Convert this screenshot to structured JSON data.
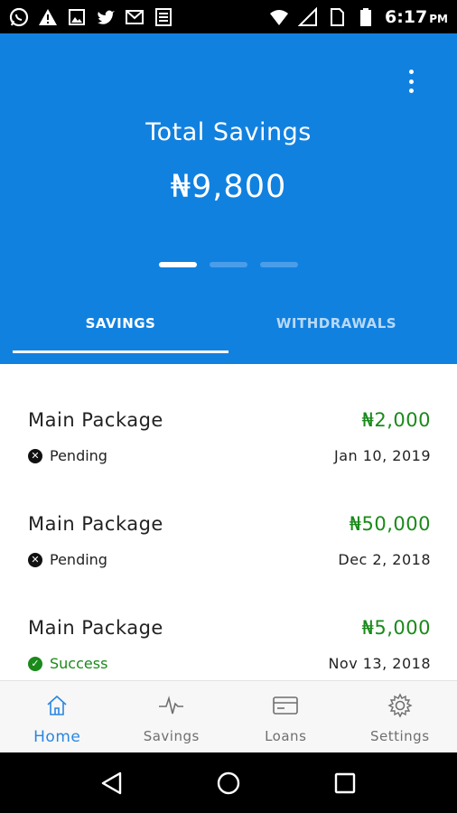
{
  "status_bar": {
    "time": "6:17",
    "ampm": "PM",
    "left_icons": [
      "whatsapp-icon",
      "warning-icon",
      "image-icon",
      "twitter-icon",
      "gmail-icon",
      "news-icon"
    ],
    "right_icons": [
      "wifi-icon",
      "signal-icon",
      "sim-icon",
      "battery-icon"
    ]
  },
  "header": {
    "title": "Total Savings",
    "total": "₦9,800",
    "pager_pages": 3,
    "pager_active": 0,
    "color": "#1181e0"
  },
  "tabs": [
    {
      "label": "SAVINGS",
      "active": true
    },
    {
      "label": "WITHDRAWALS",
      "active": false
    }
  ],
  "transactions": [
    {
      "title": "Main Package",
      "amount": "₦2,000",
      "status": "Pending",
      "date": "Jan 10, 2019"
    },
    {
      "title": "Main Package",
      "amount": "₦50,000",
      "status": "Pending",
      "date": "Dec 2, 2018"
    },
    {
      "title": "Main Package",
      "amount": "₦5,000",
      "status": "Success",
      "date": "Nov 13, 2018"
    }
  ],
  "bottom_nav": [
    {
      "label": "Home",
      "icon": "home-icon",
      "active": true
    },
    {
      "label": "Savings",
      "icon": "pulse-icon",
      "active": false
    },
    {
      "label": "Loans",
      "icon": "card-icon",
      "active": false
    },
    {
      "label": "Settings",
      "icon": "gear-icon",
      "active": false
    }
  ],
  "colors": {
    "accent": "#1181e0",
    "success": "#1a8a1a",
    "nav_active": "#2a86e2"
  }
}
